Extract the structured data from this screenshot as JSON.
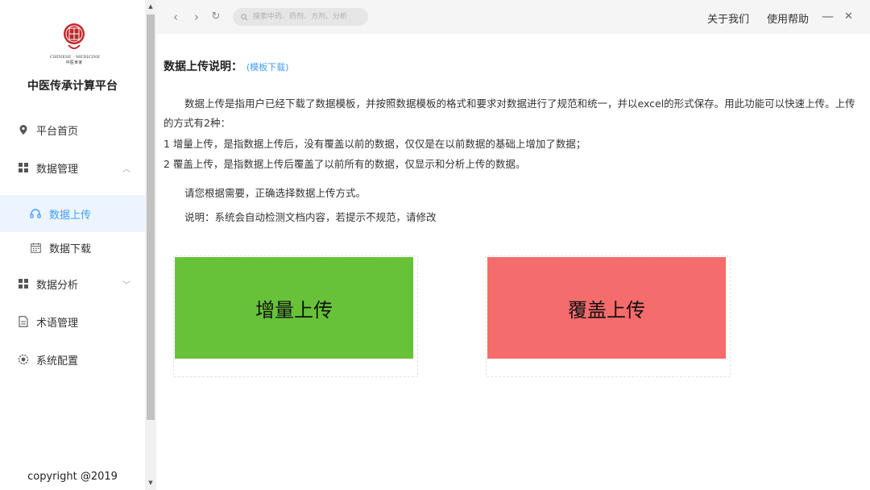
{
  "sidebar": {
    "logo": {
      "subtitle": "CHINESE · MEDICINE",
      "subtitle2": "中医世家"
    },
    "title": "中医传承计算平台",
    "items": [
      {
        "label": "平台首页",
        "icon": "location-icon"
      },
      {
        "label": "数据管理",
        "icon": "grid-icon",
        "arrow": "︿"
      },
      {
        "label": "数据上传",
        "icon": "headset-icon"
      },
      {
        "label": "数据下载",
        "icon": "calendar-icon"
      },
      {
        "label": "数据分析",
        "icon": "grid-icon",
        "arrow": "﹀"
      },
      {
        "label": "术语管理",
        "icon": "document-icon"
      },
      {
        "label": "系统配置",
        "icon": "gear-icon"
      }
    ],
    "copyright": "copyright @2019"
  },
  "topbar": {
    "back": "‹",
    "forward": "›",
    "refresh": "↻",
    "search_placeholder": "搜索中药、药剂、方剂、分析",
    "about": "关于我们",
    "help": "使用帮助",
    "minimize": "—",
    "close": "✕"
  },
  "main": {
    "heading": "数据上传说明：",
    "template_link": "(模板下载)",
    "intro": "数据上传是指用户已经下载了数据模板，并按照数据模板的格式和要求对数据进行了规范和统一，并以excel的形式保存。用此功能可以快速上传。上传的方式有2种：",
    "mode1": "1 增量上传，是指数据上传后，没有覆盖以前的数据，仅仅是在以前数据的基础上增加了数据；",
    "mode2": "2 覆盖上传，是指数据上传后覆盖了以前所有的数据，仅显示和分析上传的数据。",
    "prompt": "请您根据需要，正确选择数据上传方式。",
    "note": "说明：系统会自动检测文档内容，若提示不规范，请修改",
    "incremental_button": "增量上传",
    "overwrite_button": "覆盖上传"
  },
  "colors": {
    "accent": "#409eff",
    "green": "#67c23a",
    "red": "#f56c6c"
  }
}
